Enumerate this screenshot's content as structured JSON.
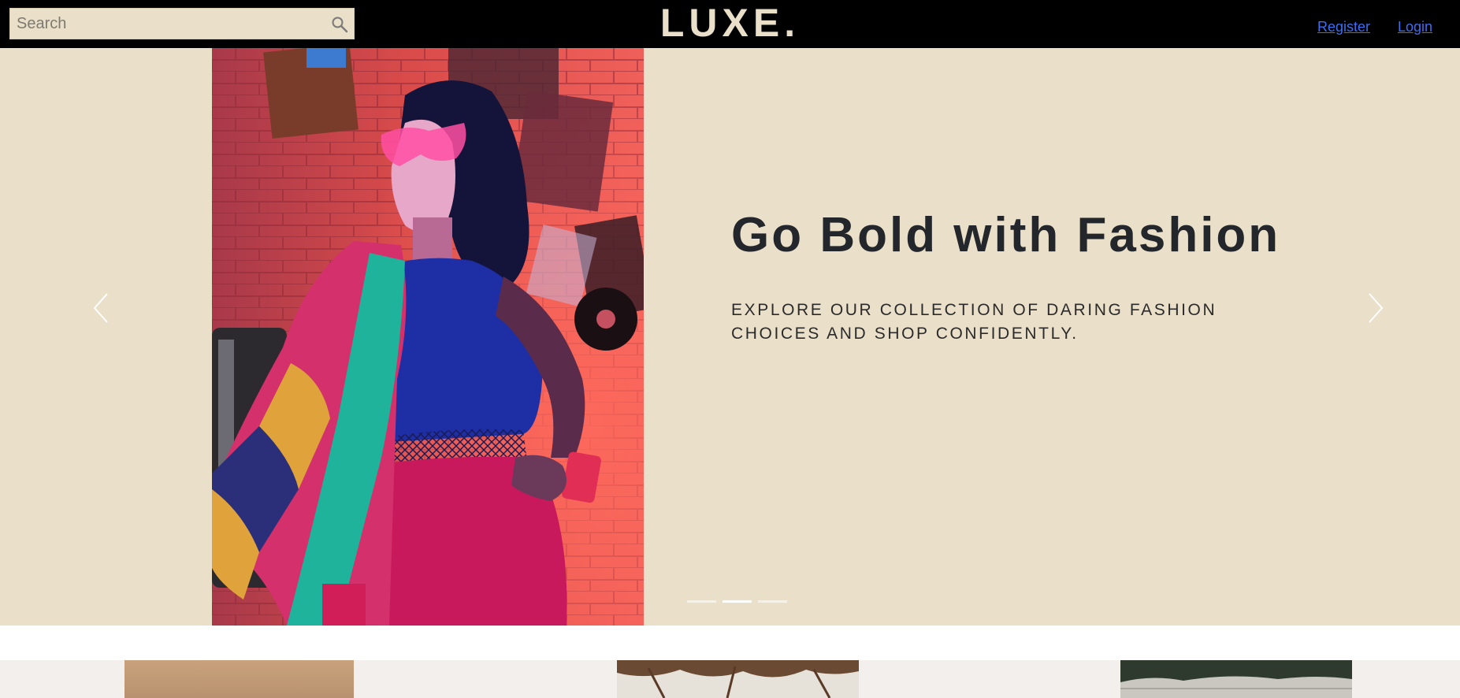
{
  "header": {
    "search": {
      "placeholder": "Search",
      "value": ""
    },
    "logo": "LUXE.",
    "nav": {
      "register": "Register",
      "login": "Login"
    }
  },
  "hero": {
    "title": "Go Bold with Fashion",
    "subtitle": "EXPLORE OUR COLLECTION OF DARING FASHION CHOICES AND SHOP CONFIDENTLY.",
    "active_slide": 2,
    "slide_count": 3
  },
  "colors": {
    "topbar": "#000000",
    "cream": "#eadfc8",
    "title_text": "#23262b",
    "link": "#3d6df2",
    "strip_bg": "#f3efec"
  },
  "icons": {
    "search": "search-icon",
    "prev": "chevron-left-icon",
    "next": "chevron-right-icon"
  }
}
